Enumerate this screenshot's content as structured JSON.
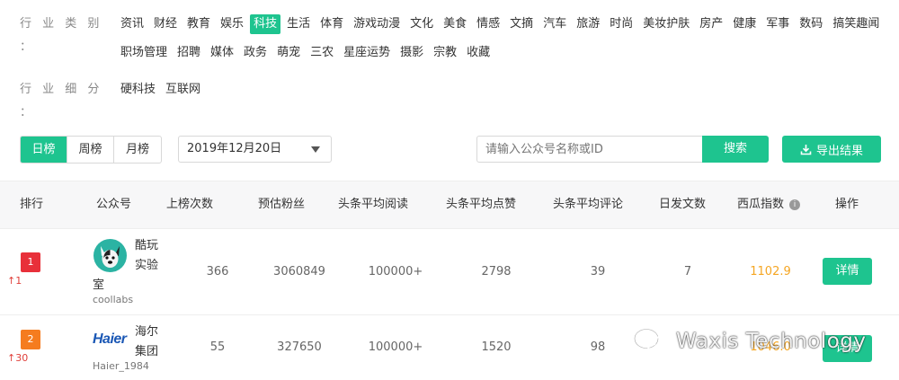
{
  "filters": {
    "industry_label": "行 业 类 别 ：",
    "industry_tags": [
      "资讯",
      "财经",
      "教育",
      "娱乐",
      "科技",
      "生活",
      "体育",
      "游戏动漫",
      "文化",
      "美食",
      "情感",
      "文摘",
      "汽车",
      "旅游",
      "时尚",
      "美妆护肤",
      "房产",
      "健康",
      "军事",
      "数码",
      "搞笑趣闻",
      "职场管理",
      "招聘",
      "媒体",
      "政务",
      "萌宠",
      "三农",
      "星座运势",
      "摄影",
      "宗教",
      "收藏"
    ],
    "industry_active": "科技",
    "sub_label": "行 业 细 分 ：",
    "sub_tags": [
      "硬科技",
      "互联网"
    ]
  },
  "toolbar": {
    "periods": [
      "日榜",
      "周榜",
      "月榜"
    ],
    "active_period": "日榜",
    "date_value": "2019年12月20日",
    "search_placeholder": "请输入公众号名称或ID",
    "search_label": "搜索",
    "export_label": "导出结果"
  },
  "table": {
    "headers": {
      "rank": "排行",
      "account": "公众号",
      "times": "上榜次数",
      "fans": "预估粉丝",
      "reads": "头条平均阅读",
      "likes": "头条平均点赞",
      "comments": "头条平均评论",
      "daily": "日发文数",
      "index": "西瓜指数",
      "action": "操作"
    },
    "rows": [
      {
        "rank": "1",
        "rank_color": "#e8303a",
        "delta": "↑1",
        "name_line1": "酷玩",
        "name_line2": "实验",
        "name_line3": "室",
        "id": "coollabs",
        "avatar": "dog-avatar",
        "times": "366",
        "fans": "3060849",
        "reads": "100000+",
        "likes": "2798",
        "comments": "39",
        "daily": "7",
        "index": "1102.9",
        "action": "详情"
      },
      {
        "rank": "2",
        "rank_color": "#f57c1f",
        "delta": "↑30",
        "name_line1": "海尔",
        "name_line2": "集团",
        "logo_text": "Haier",
        "id": "Haier_1984",
        "avatar": "haier-logo",
        "times": "55",
        "fans": "327650",
        "reads": "100000+",
        "likes": "1520",
        "comments": "98",
        "daily": "",
        "index": "1046.0",
        "action": "详情"
      }
    ]
  },
  "watermark": {
    "text": "Waxis Technology",
    "icon": "wechat-icon"
  },
  "colors": {
    "accent": "#1ec48f",
    "index": "#f5a623",
    "delta_up": "#e0403b"
  }
}
